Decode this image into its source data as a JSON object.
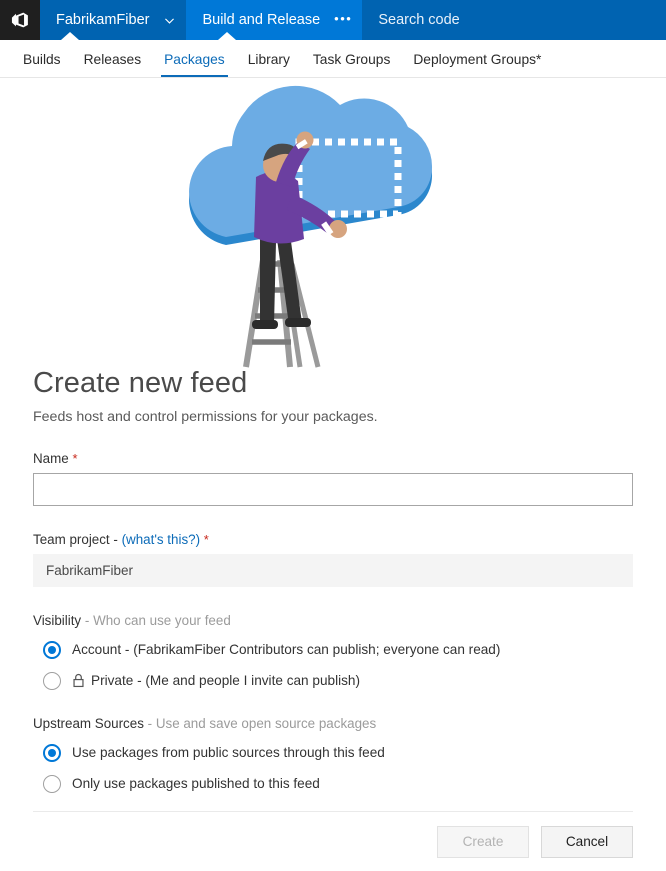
{
  "top_nav": {
    "logo_icon": "azure-devops-logo-icon",
    "project_name": "FabrikamFiber",
    "project_chevron_icon": "chevron-down-icon",
    "active_hub": "Build and Release",
    "hub_more_icon": "ellipsis-icon",
    "hub_more_label": "•••",
    "search_placeholder": "Search code",
    "colors": {
      "bar": "#0063b1",
      "active_hub": "#0078d7",
      "logo_tile": "#1f1f1f"
    }
  },
  "sub_nav": {
    "items": [
      {
        "label": "Builds",
        "active": false
      },
      {
        "label": "Releases",
        "active": false
      },
      {
        "label": "Packages",
        "active": true
      },
      {
        "label": "Library",
        "active": false
      },
      {
        "label": "Task Groups",
        "active": false
      },
      {
        "label": "Deployment Groups*",
        "active": false
      }
    ],
    "accent_color": "#0c6bb8"
  },
  "hero": {
    "illustration_name": "person-on-ladder-hanging-frame-on-cloud-illustration",
    "colors": {
      "cloud": "#6cace4",
      "cloud_shadow": "#2b87cd",
      "shirt": "#6b3fa0",
      "pants": "#333333",
      "skin": "#d6a47f",
      "hair": "#4a4a4a",
      "ladder": "#9a9a9a",
      "ladder_dark": "#7a7a7a",
      "frame_dash": "#ffffff"
    }
  },
  "form": {
    "title": "Create new feed",
    "subtitle": "Feeds host and control permissions for your packages.",
    "name": {
      "label": "Name",
      "required_mark": "*",
      "value": "",
      "placeholder": ""
    },
    "team_project": {
      "label": "Team project",
      "separator": "-",
      "help_link": "(what's this?)",
      "required_mark": "*",
      "value": "FabrikamFiber"
    },
    "visibility": {
      "label": "Visibility",
      "separator": "-",
      "hint": "Who can use your feed",
      "options": [
        {
          "label": "Account - (FabrikamFiber Contributors can publish; everyone can read)",
          "selected": true,
          "icon": null
        },
        {
          "label": "Private - (Me and people I invite can publish)",
          "selected": false,
          "icon": "lock-icon"
        }
      ]
    },
    "upstream_sources": {
      "label": "Upstream Sources",
      "separator": "-",
      "hint": "Use and save open source packages",
      "options": [
        {
          "label": "Use packages from public sources through this feed",
          "selected": true
        },
        {
          "label": "Only use packages published to this feed",
          "selected": false
        }
      ]
    }
  },
  "footer": {
    "create_label": "Create",
    "create_disabled": true,
    "cancel_label": "Cancel"
  }
}
